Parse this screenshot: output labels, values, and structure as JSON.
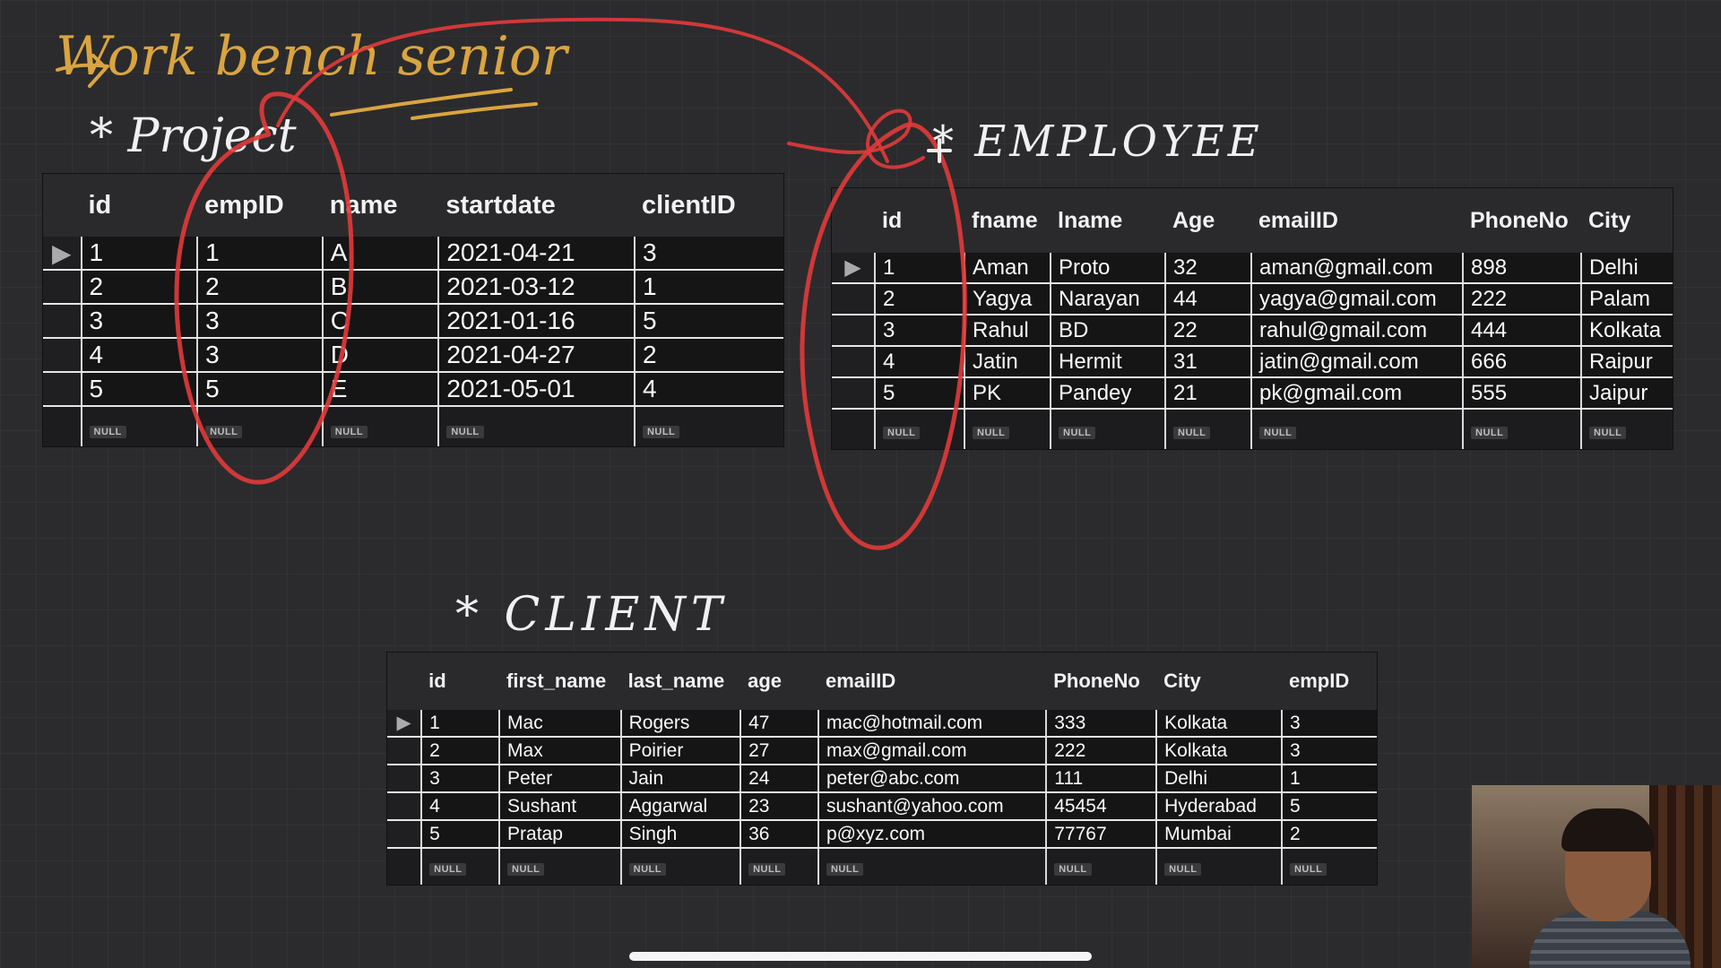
{
  "annotations": {
    "heading": "Work bench senior",
    "project_label": "* Project",
    "employee_label": "* EMPLOYEE",
    "client_label": "* CLIENT",
    "ink_color": "#d9a441",
    "marker_color": "#e23a3a"
  },
  "null_text": "NULL",
  "project": {
    "columns": [
      "id",
      "empID",
      "name",
      "startdate",
      "clientID"
    ],
    "rows": [
      [
        "1",
        "1",
        "A",
        "2021-04-21",
        "3"
      ],
      [
        "2",
        "2",
        "B",
        "2021-03-12",
        "1"
      ],
      [
        "3",
        "3",
        "C",
        "2021-01-16",
        "5"
      ],
      [
        "4",
        "3",
        "D",
        "2021-04-27",
        "2"
      ],
      [
        "5",
        "5",
        "E",
        "2021-05-01",
        "4"
      ]
    ]
  },
  "employee": {
    "columns": [
      "id",
      "fname",
      "lname",
      "Age",
      "emailID",
      "PhoneNo",
      "City"
    ],
    "rows": [
      [
        "1",
        "Aman",
        "Proto",
        "32",
        "aman@gmail.com",
        "898",
        "Delhi"
      ],
      [
        "2",
        "Yagya",
        "Narayan",
        "44",
        "yagya@gmail.com",
        "222",
        "Palam"
      ],
      [
        "3",
        "Rahul",
        "BD",
        "22",
        "rahul@gmail.com",
        "444",
        "Kolkata"
      ],
      [
        "4",
        "Jatin",
        "Hermit",
        "31",
        "jatin@gmail.com",
        "666",
        "Raipur"
      ],
      [
        "5",
        "PK",
        "Pandey",
        "21",
        "pk@gmail.com",
        "555",
        "Jaipur"
      ]
    ]
  },
  "client": {
    "columns": [
      "id",
      "first_name",
      "last_name",
      "age",
      "emailID",
      "PhoneNo",
      "City",
      "empID"
    ],
    "rows": [
      [
        "1",
        "Mac",
        "Rogers",
        "47",
        "mac@hotmail.com",
        "333",
        "Kolkata",
        "3"
      ],
      [
        "2",
        "Max",
        "Poirier",
        "27",
        "max@gmail.com",
        "222",
        "Kolkata",
        "3"
      ],
      [
        "3",
        "Peter",
        "Jain",
        "24",
        "peter@abc.com",
        "111",
        "Delhi",
        "1"
      ],
      [
        "4",
        "Sushant",
        "Aggarwal",
        "23",
        "sushant@yahoo.com",
        "45454",
        "Hyderabad",
        "5"
      ],
      [
        "5",
        "Pratap",
        "Singh",
        "36",
        "p@xyz.com",
        "77767",
        "Mumbai",
        "2"
      ]
    ]
  },
  "row_marker": "▶"
}
